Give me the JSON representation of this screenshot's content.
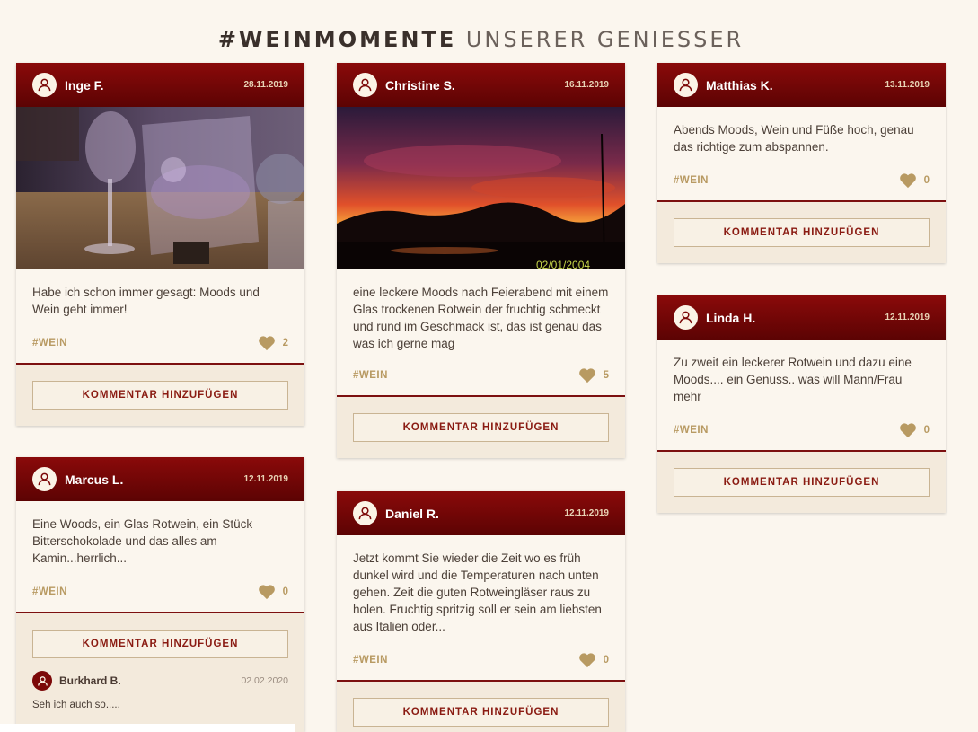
{
  "header": {
    "title_strong": "#WEINMOMENTE",
    "title_light": "UNSERER GENIESSER"
  },
  "comment_button_label": "KOMMENTAR HINZUFÜGEN",
  "colors": {
    "header_red": "#6e0505",
    "gold": "#b89a62",
    "background": "#fbf6ee"
  },
  "posts": [
    {
      "author": "Inge F.",
      "date": "28.11.2019",
      "text": "Habe ich schon immer gesagt: Moods und Wein geht immer!",
      "tag": "#WEIN",
      "likes": "2",
      "image": "photo-wine-glasses"
    },
    {
      "author": "Marcus L.",
      "date": "12.11.2019",
      "text": "Eine Woods, ein Glas Rotwein, ein Stück Bitterschokolade und das alles am Kamin...herrlich...",
      "tag": "#WEIN",
      "likes": "0",
      "comment": {
        "author": "Burkhard B.",
        "date": "02.02.2020",
        "text": "Seh ich auch so....."
      }
    },
    {
      "author": "Christine S.",
      "date": "16.11.2019",
      "text": "eine leckere Moods nach Feierabend mit einem Glas trockenen Rotwein der fruchtig schmeckt und rund im Geschmack ist, das ist genau das was ich gerne mag",
      "tag": "#WEIN",
      "likes": "5",
      "image": "photo-sunset",
      "image_stamp": "02/01/2004"
    },
    {
      "author": "Daniel R.",
      "date": "12.11.2019",
      "text": "Jetzt kommt Sie wieder die Zeit wo es früh dunkel wird und die Temperaturen nach unten gehen. Zeit die guten Rotweingläser raus zu holen. Fruchtig spritzig soll er sein am liebsten aus Italien oder...",
      "tag": "#WEIN",
      "likes": "0"
    },
    {
      "author": "Matthias K.",
      "date": "13.11.2019",
      "text": "Abends Moods, Wein und Füße hoch, genau das richtige zum abspannen.",
      "tag": "#WEIN",
      "likes": "0"
    },
    {
      "author": "Linda H.",
      "date": "12.11.2019",
      "text": "Zu zweit ein leckerer Rotwein und dazu eine Moods.... ein Genuss.. was will Mann/Frau mehr",
      "tag": "#WEIN",
      "likes": "0"
    }
  ]
}
